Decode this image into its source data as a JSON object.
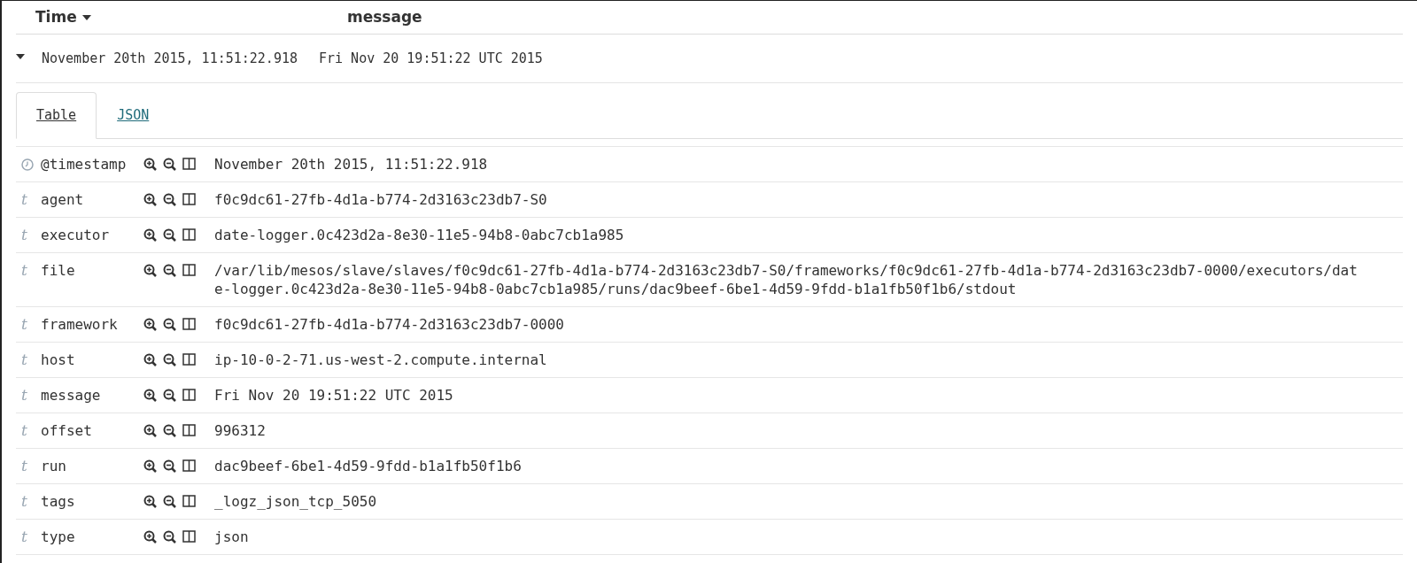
{
  "columns": [
    {
      "label": "Time",
      "sorted": true
    },
    {
      "label": "message",
      "sorted": false
    }
  ],
  "row": {
    "expanded": true,
    "time": "November 20th 2015, 11:51:22.918",
    "message": "Fri Nov 20 19:51:22 UTC 2015"
  },
  "tabs": [
    {
      "label": "Table",
      "selected": true
    },
    {
      "label": "JSON",
      "selected": false
    }
  ],
  "fields": [
    {
      "kind": "date",
      "name": "@timestamp",
      "value": "November 20th 2015, 11:51:22.918"
    },
    {
      "kind": "string",
      "type_glyph": "t",
      "name": "agent",
      "value": "f0c9dc61-27fb-4d1a-b774-2d3163c23db7-S0"
    },
    {
      "kind": "string",
      "type_glyph": "t",
      "name": "executor",
      "value": "date-logger.0c423d2a-8e30-11e5-94b8-0abc7cb1a985"
    },
    {
      "kind": "string",
      "type_glyph": "t",
      "name": "file",
      "value": "/var/lib/mesos/slave/slaves/f0c9dc61-27fb-4d1a-b774-2d3163c23db7-S0/frameworks/f0c9dc61-27fb-4d1a-b774-2d3163c23db7-0000/executors/date-logger.0c423d2a-8e30-11e5-94b8-0abc7cb1a985/runs/dac9beef-6be1-4d59-9fdd-b1a1fb50f1b6/stdout"
    },
    {
      "kind": "string",
      "type_glyph": "t",
      "name": "framework",
      "value": "f0c9dc61-27fb-4d1a-b774-2d3163c23db7-0000"
    },
    {
      "kind": "string",
      "type_glyph": "t",
      "name": "host",
      "value": "ip-10-0-2-71.us-west-2.compute.internal"
    },
    {
      "kind": "string",
      "type_glyph": "t",
      "name": "message",
      "value": "Fri Nov 20 19:51:22 UTC 2015"
    },
    {
      "kind": "string",
      "type_glyph": "t",
      "name": "offset",
      "value": "996312"
    },
    {
      "kind": "string",
      "type_glyph": "t",
      "name": "run",
      "value": "dac9beef-6be1-4d59-9fdd-b1a1fb50f1b6"
    },
    {
      "kind": "string",
      "type_glyph": "t",
      "name": "tags",
      "value": "_logz_json_tcp_5050"
    },
    {
      "kind": "string",
      "type_glyph": "t",
      "name": "type",
      "value": "json"
    }
  ]
}
